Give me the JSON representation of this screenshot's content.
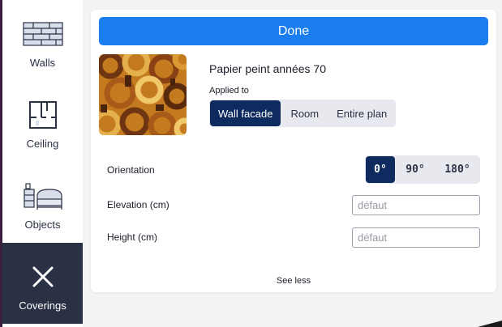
{
  "sidebar": {
    "items": [
      {
        "label": "Walls",
        "icon": "brick-wall-icon"
      },
      {
        "label": "Ceiling",
        "icon": "floorplan-icon"
      },
      {
        "label": "Objects",
        "icon": "furniture-icon"
      },
      {
        "label": "Coverings",
        "icon": "close-icon"
      }
    ],
    "active": "Coverings",
    "active_color": "#2b3145"
  },
  "panel": {
    "done_label": "Done",
    "done_color": "#1a7ef0",
    "covering_name": "Papier peint années 70",
    "applied_to_label": "Applied to",
    "applied_to_options": [
      "Wall facade",
      "Room",
      "Entire plan"
    ],
    "applied_to_selected": "Wall facade",
    "orientation": {
      "label": "Orientation",
      "options": [
        "0°",
        "90°",
        "180°"
      ],
      "selected": "0°"
    },
    "elevation": {
      "label": "Elevation (cm)",
      "placeholder": "défaut",
      "value": ""
    },
    "height": {
      "label": "Height (cm)",
      "placeholder": "défaut",
      "value": ""
    },
    "see_less_label": "See less",
    "selected_color": "#0d2b5e"
  }
}
